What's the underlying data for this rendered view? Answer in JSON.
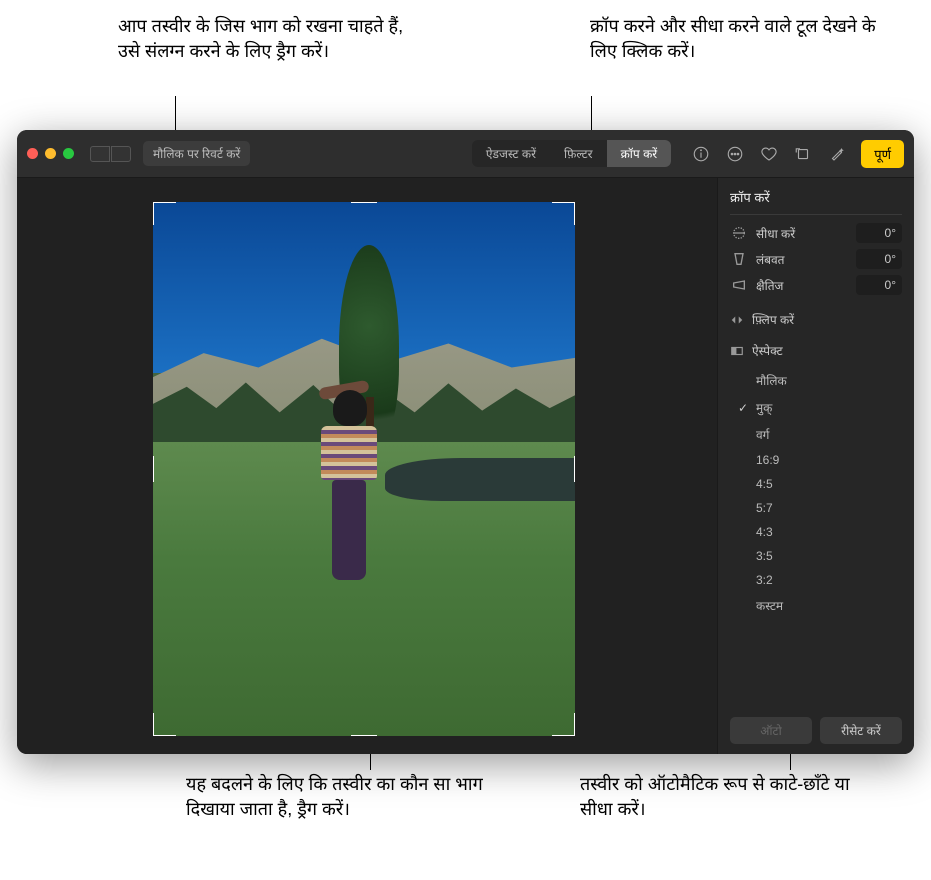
{
  "callouts": {
    "top_left": "आप तस्वीर के जिस भाग को रखना चाहते हैं, उसे संलग्न करने के लिए ड्रैग करें।",
    "top_right": "क्रॉप करने और सीधा करने वाले टूल देखने के लिए क्लिक करें।",
    "bottom_left": "यह बदलने के लिए कि तस्वीर का कौन सा भाग दिखाया जाता है, ड्रैग करें।",
    "bottom_right": "तस्वीर को ऑटोमैटिक रूप से काटे-छाँटे या सीधा करें।"
  },
  "toolbar": {
    "revert": "मौलिक पर रिवर्ट करें",
    "adjust": "ऐडजस्ट करें",
    "filter": "फ़िल्टर",
    "crop": "क्रॉप करें",
    "done": "पूर्ण"
  },
  "panel": {
    "title": "क्रॉप करें",
    "straighten": {
      "label": "सीधा करें",
      "value": "0°"
    },
    "vertical": {
      "label": "लंबवत",
      "value": "0°"
    },
    "horizontal": {
      "label": "क्षैतिज",
      "value": "0°"
    },
    "flip": "फ़्लिप करें",
    "aspect": "ऐस्पेक्ट",
    "aspect_options": {
      "original": "मौलिक",
      "free": "मुक्",
      "square": "वर्ग",
      "r16_9": "16:9",
      "r4_5": "4:5",
      "r5_7": "5:7",
      "r4_3": "4:3",
      "r3_5": "3:5",
      "r3_2": "3:2",
      "custom": "कस्टम"
    },
    "auto": "ऑटो",
    "reset": "रीसेट करें"
  }
}
